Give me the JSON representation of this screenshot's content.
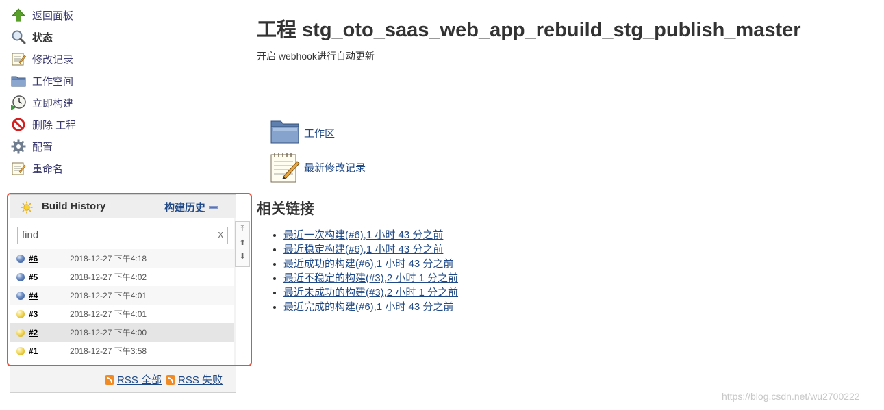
{
  "tasks": [
    {
      "label": "返回面板",
      "icon": "up-arrow-icon"
    },
    {
      "label": "状态",
      "icon": "magnifier-icon"
    },
    {
      "label": "修改记录",
      "icon": "notepad-icon"
    },
    {
      "label": "工作空间",
      "icon": "folder-icon"
    },
    {
      "label": "立即构建",
      "icon": "clock-icon"
    },
    {
      "label": "删除 工程",
      "icon": "no-entry-icon"
    },
    {
      "label": "配置",
      "icon": "gear-icon"
    },
    {
      "label": "重命名",
      "icon": "notepad-icon"
    }
  ],
  "build_history": {
    "title": "Build History",
    "trend_link": "构建历史",
    "search_placeholder": "find",
    "clear_label": "x",
    "builds": [
      {
        "number": "#6",
        "date": "2018-12-27 下午4:18",
        "status": "blue"
      },
      {
        "number": "#5",
        "date": "2018-12-27 下午4:02",
        "status": "blue"
      },
      {
        "number": "#4",
        "date": "2018-12-27 下午4:01",
        "status": "blue"
      },
      {
        "number": "#3",
        "date": "2018-12-27 下午4:01",
        "status": "yellow"
      },
      {
        "number": "#2",
        "date": "2018-12-27 下午4:00",
        "status": "yellow"
      },
      {
        "number": "#1",
        "date": "2018-12-27 下午3:58",
        "status": "yellow"
      }
    ],
    "rss_all": "RSS 全部",
    "rss_failed": "RSS 失败"
  },
  "main": {
    "title": "工程 stg_oto_saas_web_app_rebuild_stg_publish_master",
    "description": "开启 webhook进行自动更新",
    "workspace_link": "工作区",
    "changes_link": "最新修改记录",
    "related_title": "相关链接",
    "permalinks": [
      "最近一次构建(#6),1 小时 43 分之前",
      "最近稳定构建(#6),1 小时 43 分之前",
      "最近成功的构建(#6),1 小时 43 分之前",
      "最近不稳定的构建(#3),2 小时 1 分之前",
      "最近未成功的构建(#3),2 小时 1 分之前",
      "最近完成的构建(#6),1 小时 43 分之前"
    ]
  },
  "watermark": "https://blog.csdn.net/wu2700222",
  "colors": {
    "link": "#204a87",
    "highlight": "#e8503a",
    "stable": "#2a4d8f",
    "unstable": "#f3d85a"
  }
}
